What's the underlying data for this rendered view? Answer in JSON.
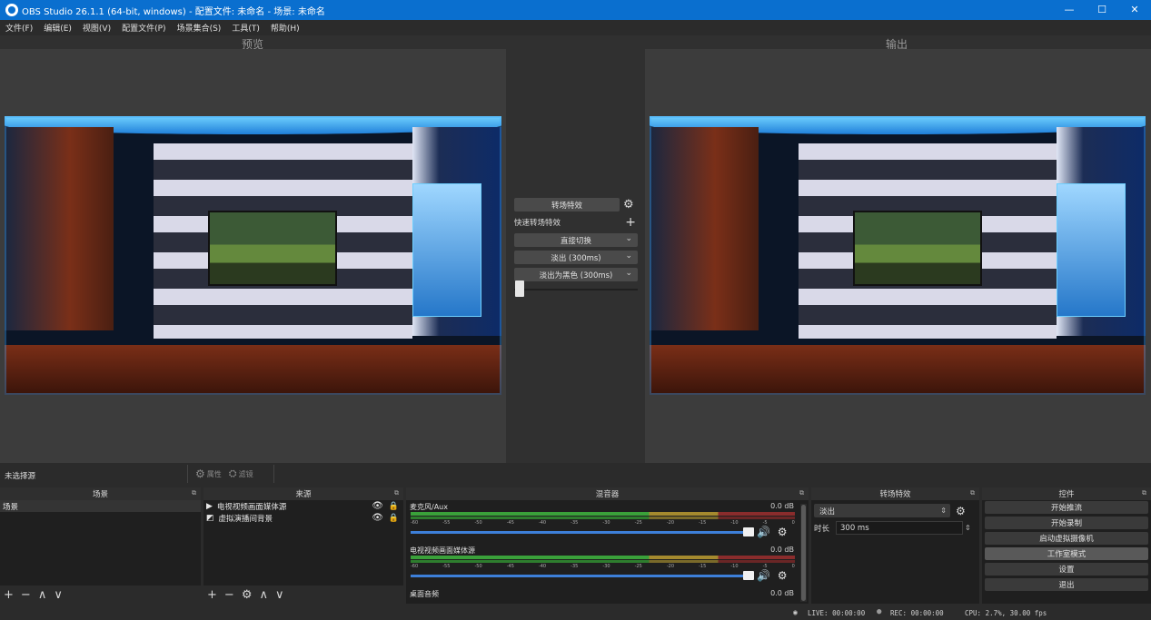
{
  "titlebar": {
    "title": "OBS Studio 26.1.1 (64-bit, windows) - 配置文件: 未命名 - 场景: 未命名",
    "minimize": "—",
    "maximize": "☐",
    "close": "✕"
  },
  "menu": [
    "文件(F)",
    "编辑(E)",
    "视图(V)",
    "配置文件(P)",
    "场景集合(S)",
    "工具(T)",
    "帮助(H)"
  ],
  "labels": {
    "preview": "预览",
    "output": "输出"
  },
  "transition_panel": {
    "transition_button": "转场特效",
    "quick_transitions": "快速转场特效",
    "items": [
      "直接切换",
      "淡出 (300ms)",
      "淡出为黑色 (300ms)"
    ],
    "slider_level": 0.0
  },
  "preview_status": {
    "no_selection": "未选择源",
    "properties": "属性",
    "filters": "滤镜"
  },
  "docks": {
    "scenes": {
      "title": "场景",
      "items": [
        "场景"
      ]
    },
    "sources": {
      "title": "来源",
      "items": [
        "电视视频画面媒体源",
        "虚拟演播间背景"
      ]
    },
    "mixer": {
      "title": "混音器",
      "channels": [
        {
          "name": "麦克风/Aux",
          "db": "0.0 dB"
        },
        {
          "name": "电视视频画面媒体源",
          "db": "0.0 dB"
        },
        {
          "name": "桌面音频",
          "db": "0.0 dB"
        }
      ],
      "ticks": [
        "-60",
        "-55",
        "-50",
        "-45",
        "-40",
        "-35",
        "-30",
        "-25",
        "-20",
        "-15",
        "-10",
        "-5",
        "0"
      ]
    },
    "transitions": {
      "title": "转场特效",
      "selected": "淡出",
      "duration_label": "时长",
      "duration_value": "300 ms"
    },
    "controls": {
      "title": "控件",
      "buttons": [
        "开始推流",
        "开始录制",
        "启动虚拟摄像机",
        "工作室模式",
        "设置",
        "退出"
      ]
    }
  },
  "status": {
    "live": "LIVE: 00:00:00",
    "rec": "REC: 00:00:00",
    "cpu": "CPU: 2.7%, 30.00 fps"
  },
  "colors": {
    "titlebar": "#0a6fcf",
    "meter_green": "#3aa13a",
    "volume_blue": "#3d7fd9"
  }
}
